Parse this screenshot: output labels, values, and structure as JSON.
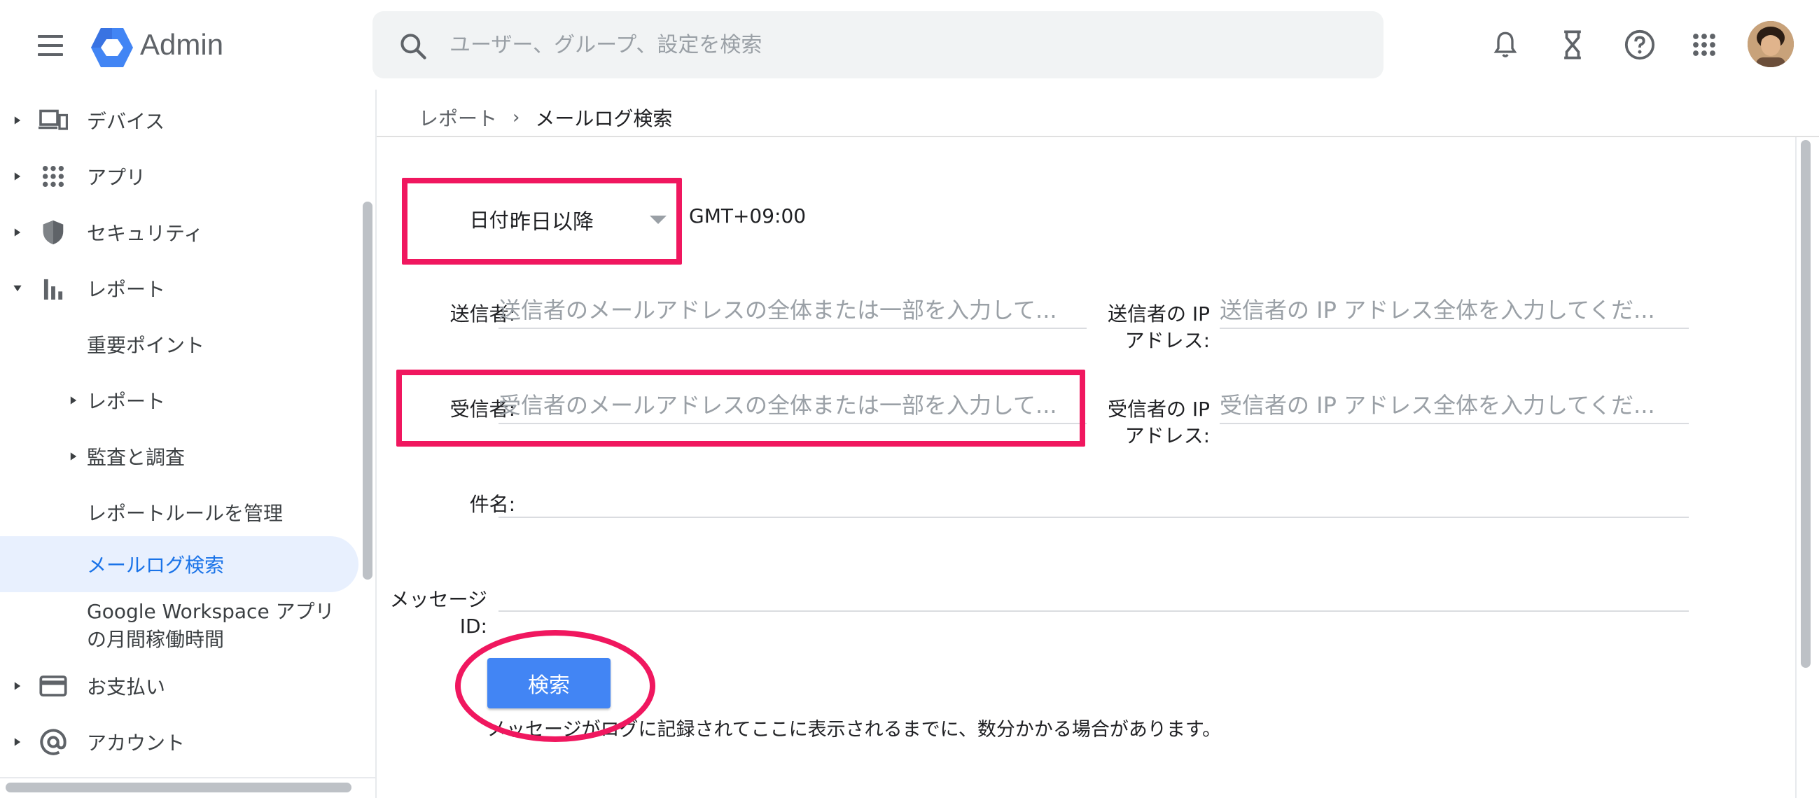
{
  "app": {
    "title": "Admin",
    "brand_color": "#4285f4"
  },
  "search": {
    "placeholder": "ユーザー、グループ、設定を検索"
  },
  "toolbar_icons": [
    "bell-icon",
    "hourglass-icon",
    "help-icon",
    "apps-grid-icon"
  ],
  "sidebar": {
    "items": [
      {
        "label": "デバイス",
        "icon": "devices-icon",
        "expandable": true
      },
      {
        "label": "アプリ",
        "icon": "apps-grid-icon",
        "expandable": true
      },
      {
        "label": "セキュリティ",
        "icon": "shield-icon",
        "expandable": true
      },
      {
        "label": "レポート",
        "icon": "bar-chart-icon",
        "expanded": true
      },
      {
        "label": "重要ポイント"
      },
      {
        "label": "レポート",
        "expandable": true
      },
      {
        "label": "監査と調査",
        "expandable": true
      },
      {
        "label": "レポートルールを管理"
      },
      {
        "label": "メールログ検索",
        "active": true
      },
      {
        "label": "Google Workspace アプリの月間稼働時間"
      },
      {
        "label": "お支払い",
        "icon": "credit-card-icon",
        "expandable": true
      },
      {
        "label": "アカウント",
        "icon": "at-sign-icon",
        "expandable": true
      }
    ]
  },
  "breadcrumb": {
    "parent": "レポート",
    "separator": "›",
    "current": "メールログ検索"
  },
  "form": {
    "date_label": "日付:",
    "date_value": "昨日以降",
    "timezone": "GMT+09:00",
    "sender_label": "送信者:",
    "sender_placeholder": "送信者のメールアドレスの全体または一部を入力して...",
    "sender_ip_label_1": "送信者の IP",
    "sender_ip_label_2": "アドレス:",
    "sender_ip_placeholder": "送信者の IP アドレス全体を入力してくだ...",
    "recipient_label": "受信者:",
    "recipient_placeholder": "受信者のメールアドレスの全体または一部を入力して...",
    "recipient_ip_label_1": "受信者の IP",
    "recipient_ip_label_2": "アドレス:",
    "recipient_ip_placeholder": "受信者の IP アドレス全体を入力してくだ...",
    "subject_label": "件名:",
    "subject_value": "",
    "message_id_label_1": "メッセージ",
    "message_id_label_2": "ID:",
    "message_id_value": "",
    "search_button": "検索",
    "note": "メッセージがログに記録されてここに表示されるまでに、数分かかる場合があります。"
  },
  "highlight_color": "#f0175f"
}
